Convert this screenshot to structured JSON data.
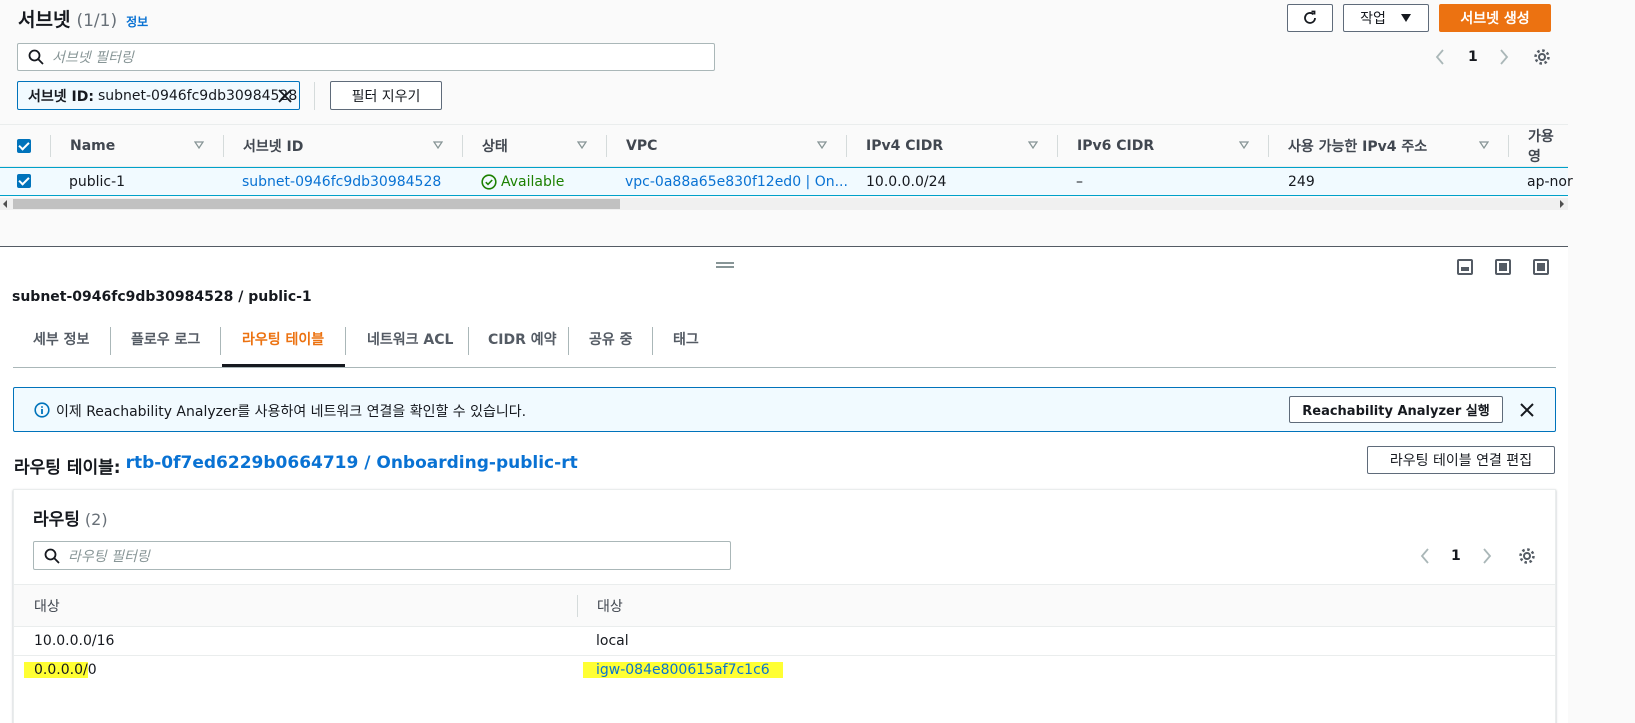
{
  "header": {
    "title": "서브넷",
    "count": "(1/1)",
    "info_link": "정보",
    "actions_label": "작업",
    "create_label": "서브넷 생성",
    "search_placeholder": "서브넷 필터링",
    "page_number": "1"
  },
  "filter": {
    "token_key": "서브넷 ID:",
    "token_value": "subnet-0946fc9db30984528",
    "clear_label": "필터 지우기"
  },
  "table": {
    "columns": [
      "Name",
      "서브넷 ID",
      "상태",
      "VPC",
      "IPv4 CIDR",
      "IPv6 CIDR",
      "사용 가능한 IPv4 주소",
      "가용 영"
    ],
    "row": {
      "name": "public-1",
      "subnet_id": "subnet-0946fc9db30984528",
      "status": "Available",
      "vpc": "vpc-0a88a65e830f12ed0 | On...",
      "ipv4": "10.0.0.0/24",
      "ipv6": "–",
      "available_ipv4": "249",
      "az": "ap-nor"
    }
  },
  "detail": {
    "title": "subnet-0946fc9db30984528 / public-1",
    "tabs": [
      "세부 정보",
      "플로우 로그",
      "라우팅 테이블",
      "네트워크 ACL",
      "CIDR 예약",
      "공유 중",
      "태그"
    ],
    "active_tab": 2
  },
  "alert": {
    "text": "이제 Reachability Analyzer를 사용하여 네트워크 연결을 확인할 수 있습니다.",
    "button_label": "Reachability Analyzer 실행"
  },
  "route_table": {
    "label": "라우팅 테이블:",
    "link": "rtb-0f7ed6229b0664719 / Onboarding-public-rt",
    "edit_label": "라우팅 테이블 연결 편집"
  },
  "routes": {
    "title": "라우팅",
    "count": "(2)",
    "search_placeholder": "라우팅 필터링",
    "page_number": "1",
    "columns": [
      "대상",
      "대상"
    ],
    "rows": [
      {
        "destination": "10.0.0.0/16",
        "target": "local"
      },
      {
        "destination_hl": "0.0.0.0/",
        "destination_rest": "0",
        "target": "igw-084e800615af7c1c6"
      }
    ]
  },
  "colors": {
    "primary": "#ec7211",
    "link": "#0972d3",
    "success": "#1d8102",
    "highlight": "#ffff33"
  }
}
